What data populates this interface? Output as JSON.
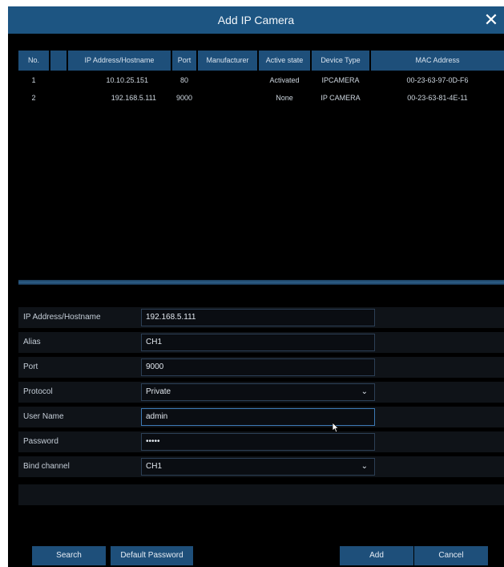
{
  "dialog": {
    "title": "Add IP Camera",
    "close_glyph": "✕"
  },
  "table": {
    "headers": {
      "no": "No.",
      "ip": "IP Address/Hostname",
      "port": "Port",
      "manufacturer": "Manufacturer",
      "active_state": "Active state",
      "device_type": "Device Type",
      "mac": "MAC Address"
    },
    "rows": [
      {
        "no": "1",
        "ip": "10.10.25.151",
        "port": "80",
        "manufacturer": "",
        "active_state": "Activated",
        "device_type": "IPCAMERA",
        "mac": "00-23-63-97-0D-F6"
      },
      {
        "no": "2",
        "ip": "192.168.5.111",
        "port": "9000",
        "manufacturer": "",
        "active_state": "None",
        "device_type": "IP CAMERA",
        "mac": "00-23-63-81-4E-11"
      }
    ]
  },
  "form": {
    "ip": {
      "label": "IP Address/Hostname",
      "value": "192.168.5.111"
    },
    "alias": {
      "label": "Alias",
      "value": "CH1"
    },
    "port": {
      "label": "Port",
      "value": "9000"
    },
    "protocol": {
      "label": "Protocol",
      "value": "Private"
    },
    "username": {
      "label": "User Name",
      "value": "admin"
    },
    "password": {
      "label": "Password",
      "value": "•••••"
    },
    "bind_channel": {
      "label": "Bind channel",
      "value": "CH1"
    },
    "chevron": "⌄"
  },
  "buttons": {
    "search": "Search",
    "default_password": "Default Password",
    "add": "Add",
    "cancel": "Cancel"
  },
  "colors": {
    "accent": "#1e4f7a",
    "background": "#000000"
  }
}
